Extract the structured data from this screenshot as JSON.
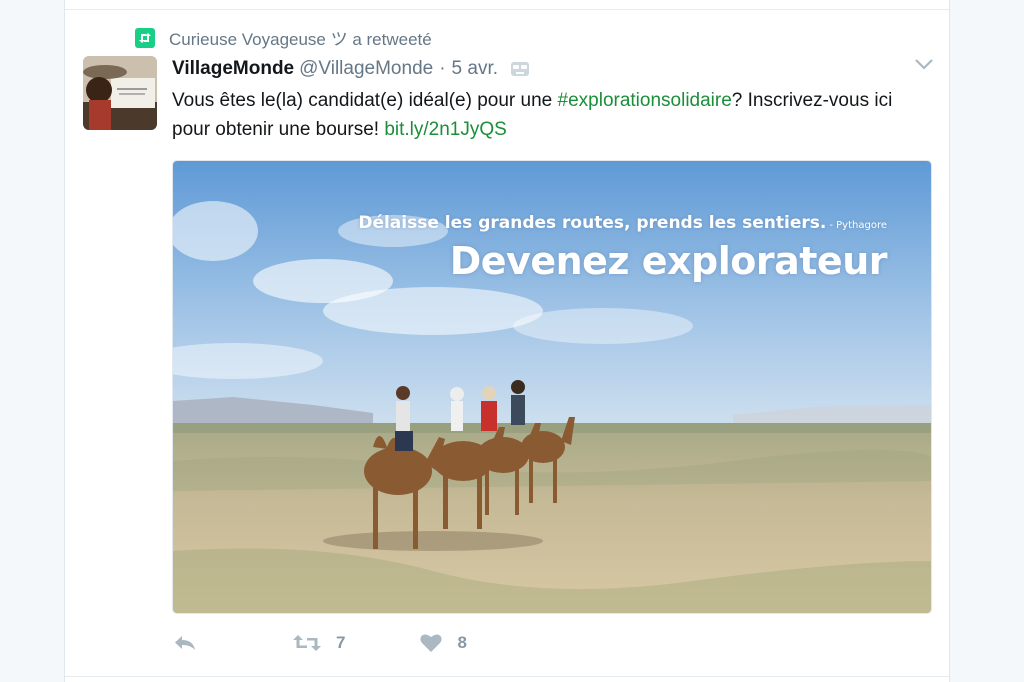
{
  "retweet_context": {
    "text": "Curieuse Voyageuse ツ a retweeté",
    "icon": "retweet-icon"
  },
  "tweet": {
    "name": "VillageMonde",
    "handle": "@VillageMonde",
    "separator": "·",
    "date": "5 avr.",
    "text_before": "Vous êtes le(la) candidat(e) idéal(e) pour une ",
    "hashtag": "#explorationsolidaire",
    "text_middle": "? Inscrivez-vous ici pour obtenir une bourse! ",
    "link": "bit.ly/2n1JyQS"
  },
  "media": {
    "quote": "Délaisse les grandes routes, prends les sentiers.",
    "quote_author": "- Pythagore",
    "headline": "Devenez explorateur"
  },
  "actions": {
    "reply_icon": "reply-icon",
    "retweet_icon": "retweet-icon",
    "retweet_count": "7",
    "like_icon": "heart-icon",
    "like_count": "8"
  },
  "colors": {
    "accent_link": "#1b8e3a",
    "retweet_badge": "#19cf86",
    "muted": "#657786"
  }
}
